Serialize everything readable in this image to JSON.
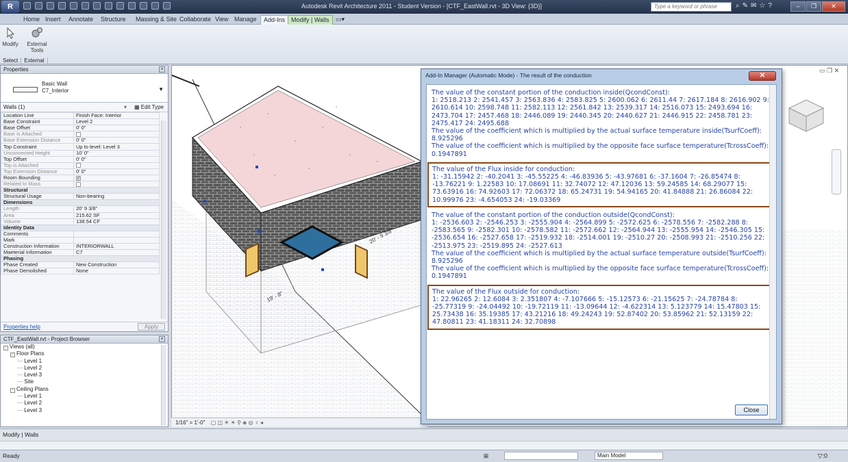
{
  "window": {
    "title": "Autodesk Revit Architecture 2011 - Student Version - [CTF_EastWall.rvt - 3D View: {3D}]",
    "search_placeholder": "Type a keyword or phrase"
  },
  "ribbon": {
    "tabs": [
      "Home",
      "Insert",
      "Annotate",
      "Structure",
      "Massing & Site",
      "Collaborate",
      "View",
      "Manage",
      "Add-Ins",
      "Modify | Walls"
    ],
    "active_tab": "Add-Ins",
    "modify_label": "Modify",
    "external_tools_label": "External Tools",
    "panel_select": "Select",
    "panel_external": "External"
  },
  "properties": {
    "title": "Properties",
    "type_family": "Basic Wall",
    "type_name": "C7_Interior",
    "filter": "Walls (1)",
    "edit_type": "Edit Type",
    "rows": [
      {
        "k": "Location Line",
        "v": "Finish Face: Interior"
      },
      {
        "k": "Base Constraint",
        "v": "Level 2"
      },
      {
        "k": "Base Offset",
        "v": "0' 0\""
      },
      {
        "k": "Base is Attached",
        "v": "",
        "check": true,
        "dim": true
      },
      {
        "k": "Base Extension Distance",
        "v": "0' 0\"",
        "dim": true
      },
      {
        "k": "Top Constraint",
        "v": "Up to level: Level 3"
      },
      {
        "k": "Unconnected Height",
        "v": "10' 0\"",
        "dim": true
      },
      {
        "k": "Top Offset",
        "v": "0' 0\""
      },
      {
        "k": "Top is Attached",
        "v": "",
        "check": true,
        "dim": true
      },
      {
        "k": "Top Extension Distance",
        "v": "0' 0\"",
        "dim": true
      },
      {
        "k": "Room Bounding",
        "v": "",
        "check": true,
        "checked": true
      },
      {
        "k": "Related to Mass",
        "v": "",
        "check": true,
        "dim": true
      },
      {
        "section": "Structural"
      },
      {
        "k": "Structural Usage",
        "v": "Non-bearing"
      },
      {
        "section": "Dimensions"
      },
      {
        "k": "Length",
        "v": "20' 9 3/8\"",
        "dim": true
      },
      {
        "k": "Area",
        "v": "215.62 SF",
        "dim": true
      },
      {
        "k": "Volume",
        "v": "138.54 CF",
        "dim": true
      },
      {
        "section": "Identity Data"
      },
      {
        "k": "Comments",
        "v": ""
      },
      {
        "k": "Mark",
        "v": ""
      },
      {
        "k": "Construction Information",
        "v": "INTERIORWALL"
      },
      {
        "k": "Maeterial Information",
        "v": "C7"
      },
      {
        "section": "Phasing"
      },
      {
        "k": "Phase Created",
        "v": "New Construction"
      },
      {
        "k": "Phase Demolished",
        "v": "None"
      }
    ],
    "help_link": "Properties help",
    "apply": "Apply"
  },
  "browser": {
    "title": "CTF_EastWall.rvt - Project Browser",
    "items": [
      {
        "label": "Views (all)",
        "level": 0,
        "box": "-"
      },
      {
        "label": "Floor Plans",
        "level": 1,
        "box": "-"
      },
      {
        "label": "Level 1",
        "level": 2
      },
      {
        "label": "Level 2",
        "level": 2
      },
      {
        "label": "Level 3",
        "level": 2
      },
      {
        "label": "Site",
        "level": 2
      },
      {
        "label": "Ceiling Plans",
        "level": 1,
        "box": "-"
      },
      {
        "label": "Level 1",
        "level": 2
      },
      {
        "label": "Level 2",
        "level": 2
      },
      {
        "label": "Level 3",
        "level": 2
      }
    ]
  },
  "view": {
    "scale": "1/16\" = 1'-0\"",
    "dim_a": "20' - 9 3/8\"",
    "dim_b": "19' - 8\""
  },
  "dialog": {
    "title": "Add-In Manager (Automatic Mode) - The result of the conduction",
    "close": "Close",
    "blocks": [
      {
        "highlight": false,
        "lines": [
          "The value of the constant portion of the conduction inside(QcondConst):",
          "1: 2518.213   2: 2541.457   3: 2563.836   4: 2583.825   5: 2600.062   6: 2611.44   7: 2617.184   8: 2616.902   9: 2610.614   10: 2598.748   11: 2582.113   12: 2561.842   13: 2539.317   14: 2516.073   15: 2493.694   16: 2473.704   17: 2457.468   18: 2446.089   19: 2440.345   20: 2440.627   21: 2446.915   22: 2458.781   23: 2475.417   24: 2495.688",
          "The value of the coefficient which is multiplied by the actual surface temperature inside(TsurfCoeff):",
          "8.925296",
          "The value of the coefficient which is multiplied by the opposite face surface temperature(TcrossCoeff):",
          "0.1947891"
        ]
      },
      {
        "highlight": true,
        "lines": [
          "The value of the Flux inside for conduction:",
          "1: -31.15942   2: -40.2041   3: -45.55225   4: -46.83936   5: -43.97681   6: -37.1604   7: -26.85474   8: -13.76221   9: 1.22583   10: 17.08691   11: 32.74072   12: 47.12036   13: 59.24585   14: 68.29077   15: 73.63916   16: 74.92603   17: 72.06372   18: 65.24731   19: 54.94165   20: 41.84888   21: 26.86084   22: 10.99976   23: -4.654053   24: -19.03369"
        ]
      },
      {
        "highlight": false,
        "lines": [
          "The value of the constant portion of the conduction outside(QcondConst):",
          "1: -2536.603   2: -2546.253   3: -2555.904   4: -2564.899   5: -2572.625   6: -2578.556   7: -2582.288   8: -2583.565   9: -2582.301   10: -2578.582   11: -2572.662   12: -2564.944   13: -2555.954   14: -2546.305   15: -2536.654   16: -2527.658   17: -2519.932   18: -2514.001   19: -2510.27   20: -2508.993   21: -2510.256   22: -2513.975   23: -2519.895   24: -2527.613",
          "The value of the coefficient which is multiplied by the actual surface temperature outside(TsurfCoeff):",
          "8.925296",
          "The value of the coefficient which is multiplied by the opposite face surface temperature(TcrossCoeff):",
          "0.1947891"
        ]
      },
      {
        "highlight": true,
        "lines": [
          "The value of the Flux outside for conduction:",
          "1: 22.96265   2: 12.6084   3: 2.351807   4: -7.107666   5: -15.12573   6: -21.15625   7: -24.78784   8: -25.77319   9: -24.04492   10: -19.72119   11: -13.09644   12: -4.622314   13: 5.123779   14: 15.47803   15: 25.73438   16: 35.19385   17: 43.21216   18: 49.24243   19: 52.87402   20: 53.85962   21: 52.13159   22: 47.80811   23: 41.18311   24: 32.70898"
        ]
      }
    ]
  },
  "status": {
    "context": "Modify | Walls",
    "ready": "Ready",
    "model": "Main Model",
    "filter_count": ":0"
  },
  "colors": {
    "result_text": "#2643a8",
    "highlight_border": "#8b4513",
    "roof_fill": "#f4d6d8"
  }
}
